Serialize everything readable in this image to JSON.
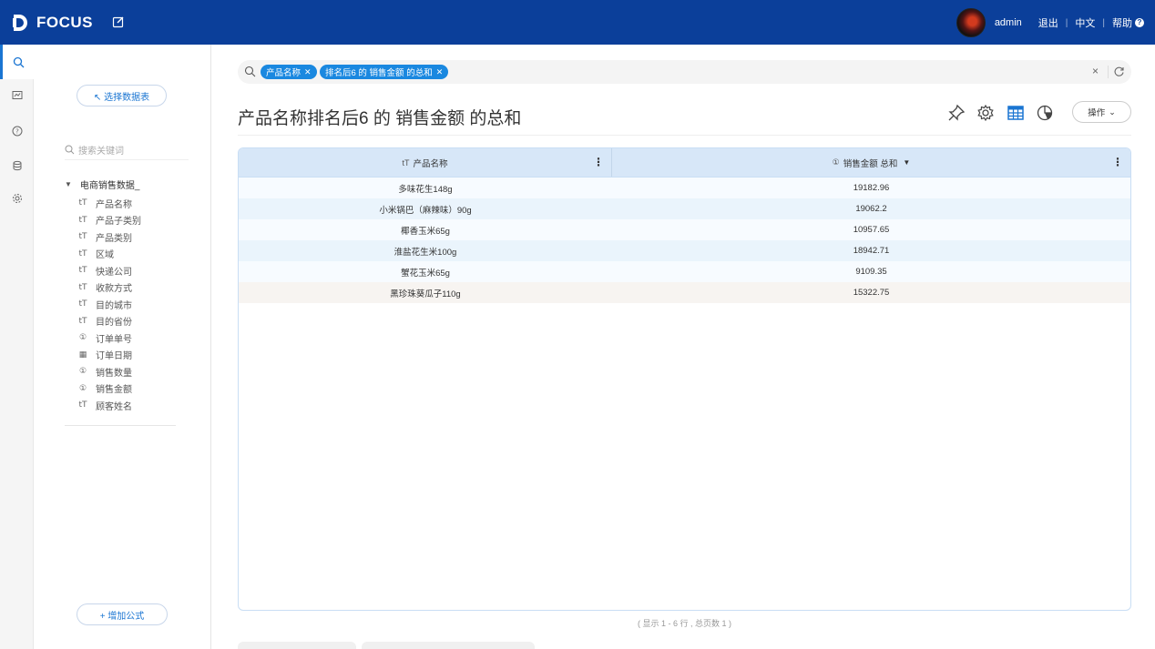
{
  "header": {
    "brand": "FOCUS",
    "user": "admin",
    "logout": "退出",
    "language": "中文",
    "help": "帮助",
    "bar_color": "#0b3f9a"
  },
  "rail": {
    "items": [
      {
        "icon": "search-icon",
        "active": true
      },
      {
        "icon": "board-icon"
      },
      {
        "icon": "help-icon"
      },
      {
        "icon": "database-icon"
      },
      {
        "icon": "settings-icon"
      }
    ]
  },
  "panel": {
    "select_table": "↖ 选择数据表",
    "search_placeholder": "搜索关键词",
    "dataset": "电商销售数据_",
    "fields": [
      {
        "type": "text",
        "icon": "tT",
        "label": "产品名称"
      },
      {
        "type": "text",
        "icon": "tT",
        "label": "产品子类别"
      },
      {
        "type": "text",
        "icon": "tT",
        "label": "产品类别"
      },
      {
        "type": "text",
        "icon": "tT",
        "label": "区域"
      },
      {
        "type": "text",
        "icon": "tT",
        "label": "快递公司"
      },
      {
        "type": "text",
        "icon": "tT",
        "label": "收款方式"
      },
      {
        "type": "text",
        "icon": "tT",
        "label": "目的城市"
      },
      {
        "type": "text",
        "icon": "tT",
        "label": "目的省份"
      },
      {
        "type": "number",
        "icon": "①",
        "label": "订单单号"
      },
      {
        "type": "date",
        "icon": "▦",
        "label": "订单日期"
      },
      {
        "type": "number",
        "icon": "①",
        "label": "销售数量"
      },
      {
        "type": "number",
        "icon": "①",
        "label": "销售金额"
      },
      {
        "type": "text",
        "icon": "tT",
        "label": "顾客姓名"
      }
    ],
    "add_formula": "+ 增加公式"
  },
  "search": {
    "tokens": [
      "产品名称",
      "排名后6 的 销售金额 的总和"
    ],
    "clear": "×"
  },
  "result": {
    "title": "产品名称排名后6 的 销售金额 的总和",
    "operations": "操作",
    "columns": [
      "产品名称",
      "销售金额 总和"
    ],
    "rows": [
      [
        "多味花生148g",
        "19182.96"
      ],
      [
        "小米锅巴（麻辣味）90g",
        "19062.2"
      ],
      [
        "椰香玉米65g",
        "10957.65"
      ],
      [
        "淮盐花生米100g",
        "18942.71"
      ],
      [
        "蟹花玉米65g",
        "9109.35"
      ],
      [
        "黑珍珠葵瓜子110g",
        "15322.75"
      ]
    ],
    "footer": "( 显示 1 - 6 行 , 总页数 1 )",
    "accent": "#1a88e0"
  }
}
